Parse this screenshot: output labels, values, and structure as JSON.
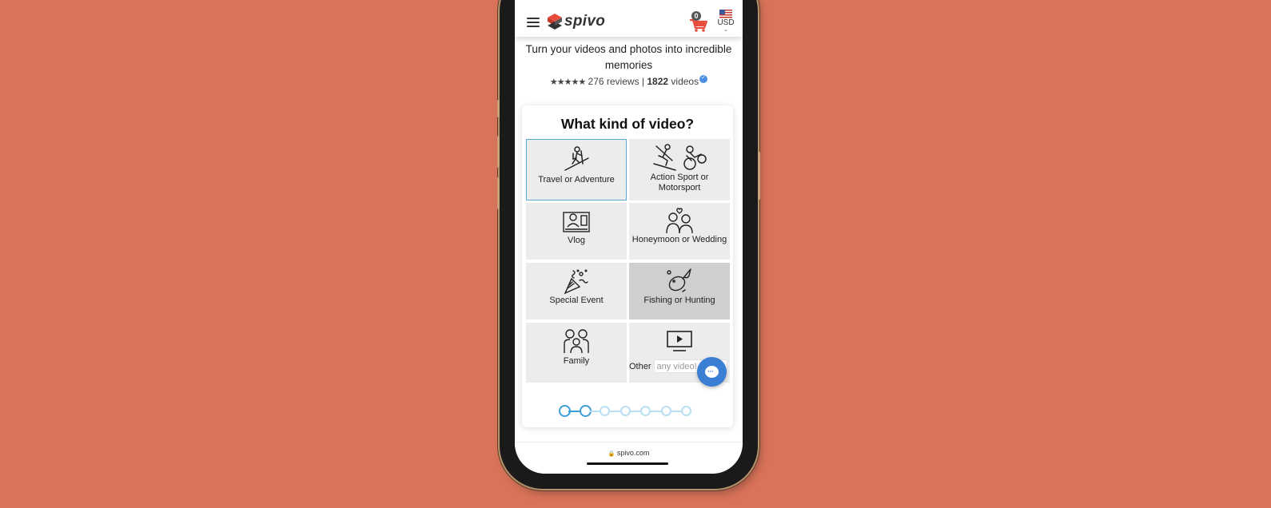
{
  "header": {
    "menu_icon": "hamburger-icon",
    "brand": "spivo",
    "cart_count": "0",
    "cart_icon": "shopping-cart-icon",
    "currency": "USD",
    "currency_flag": "us-flag-icon"
  },
  "hero": {
    "tagline": "Turn your videos and photos into incredible memories",
    "stars": "★★★★★",
    "reviews": "276 reviews",
    "separator": "|",
    "videos_count": "1822",
    "videos_label": "videos"
  },
  "card": {
    "title": "What kind of video?",
    "options": [
      {
        "label": "Travel or Adventure",
        "icon": "hiker-icon",
        "selected": true
      },
      {
        "label": "Action Sport or Motorsport",
        "icon": "skier-motorbike-icon"
      },
      {
        "label": "Vlog",
        "icon": "vlogger-icon"
      },
      {
        "label": "Honeymoon or Wedding",
        "icon": "couple-icon"
      },
      {
        "label": "Special Event",
        "icon": "party-popper-icon"
      },
      {
        "label": "Fishing or Hunting",
        "icon": "fish-hook-icon",
        "hovered": true
      },
      {
        "label": "Family",
        "icon": "family-icon"
      },
      {
        "label": "Other",
        "icon": "monitor-play-icon"
      }
    ],
    "other_input": {
      "value": "",
      "placeholder": "any video!"
    },
    "stepper": {
      "total_steps": 7,
      "completed_steps": 2
    }
  },
  "chat": {
    "icon": "chat-bubble-icon",
    "dots": "···"
  },
  "browser": {
    "url": "spivo.com",
    "lock_icon": "lock-icon"
  },
  "colors": {
    "background": "#d9735a",
    "accent": "#5aaad8",
    "step_active": "#3a9fd6",
    "step_inactive": "#b9e0f2",
    "chat": "#3b7fd4",
    "cart": "#e74c3c"
  }
}
